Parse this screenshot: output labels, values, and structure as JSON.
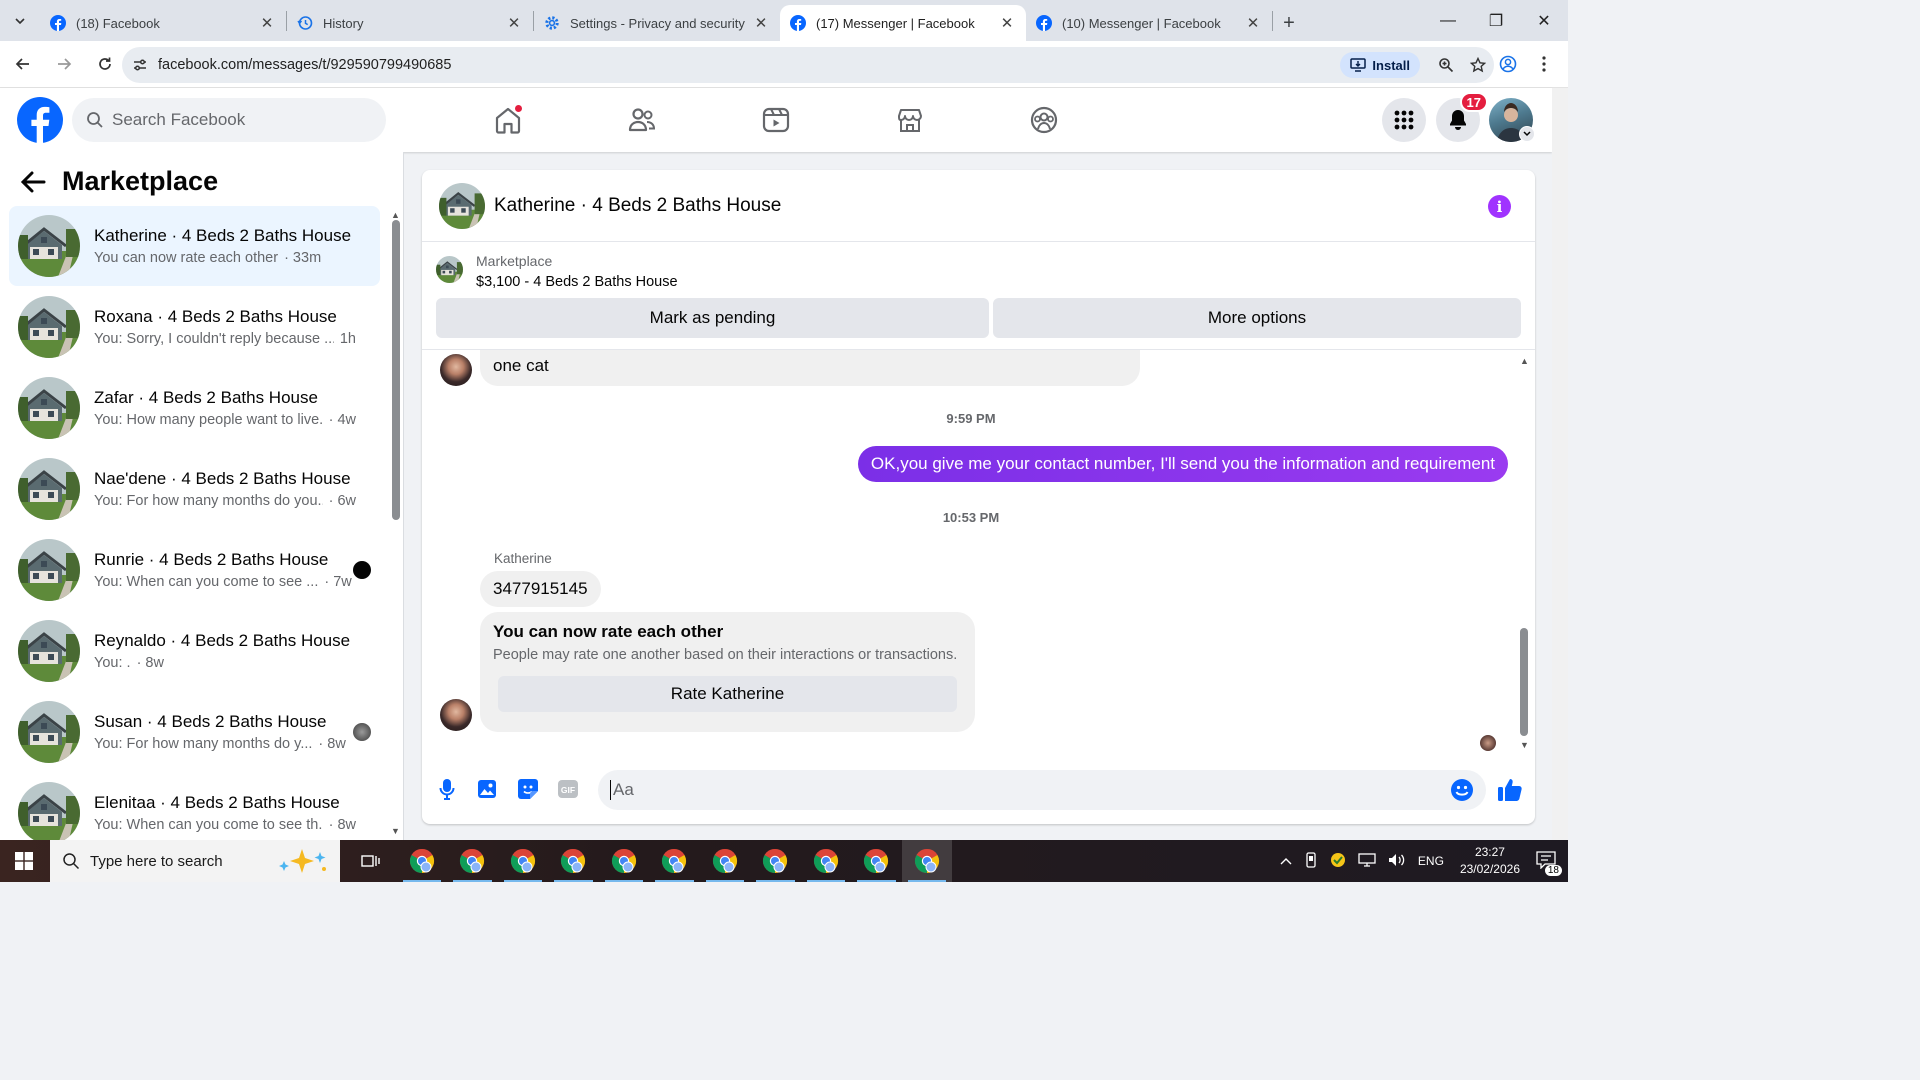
{
  "browser": {
    "tabs": [
      {
        "title": "(18) Facebook",
        "icon": "facebook-icon",
        "active": false
      },
      {
        "title": "History",
        "icon": "history-icon",
        "active": false
      },
      {
        "title": "Settings - Privacy and security",
        "icon": "gear-icon",
        "active": false
      },
      {
        "title": "(17) Messenger | Facebook",
        "icon": "facebook-icon",
        "active": true
      },
      {
        "title": "(10) Messenger | Facebook",
        "icon": "facebook-icon",
        "active": false
      }
    ],
    "url": "facebook.com/messages/t/929590799490685",
    "install_label": "Install"
  },
  "fb": {
    "search_placeholder": "Search Facebook",
    "notification_count": "17"
  },
  "sidebar": {
    "title": "Marketplace",
    "conversations": [
      {
        "name": "Katherine · 4 Beds 2 Baths House",
        "preview": "You can now rate each other",
        "time": "· 33m",
        "selected": true,
        "mark": ""
      },
      {
        "name": "Roxana · 4 Beds 2 Baths House",
        "preview": "You: Sorry, I couldn't reply because ...",
        "time": "1h",
        "selected": false,
        "mark": ""
      },
      {
        "name": "Zafar · 4 Beds 2 Baths House",
        "preview": "You: How many people want to live...",
        "time": "· 4w",
        "selected": false,
        "mark": ""
      },
      {
        "name": "Nae'dene · 4 Beds 2 Baths House",
        "preview": "You: For how many months do you...",
        "time": "· 6w",
        "selected": false,
        "mark": ""
      },
      {
        "name": "Runrie · 4 Beds 2 Baths House",
        "preview": "You: When can you come to see ...",
        "time": "· 7w",
        "selected": false,
        "mark": "unread-dot"
      },
      {
        "name": "Reynaldo · 4 Beds 2 Baths House",
        "preview": "You: .",
        "time": "· 8w",
        "selected": false,
        "mark": ""
      },
      {
        "name": "Susan · 4 Beds 2 Baths House",
        "preview": "You: For how many months do y...",
        "time": "· 8w",
        "selected": false,
        "mark": "seen-avatar"
      },
      {
        "name": "Elenitaa · 4 Beds 2 Baths House",
        "preview": "You: When can you come to see th...",
        "time": "· 8w",
        "selected": false,
        "mark": ""
      }
    ]
  },
  "chat": {
    "title": "Katherine · 4 Beds 2 Baths House",
    "marketplace_label": "Marketplace",
    "listing": "$3,100 - 4 Beds 2 Baths House",
    "mark_pending_label": "Mark as pending",
    "more_options_label": "More options",
    "messages": {
      "incoming_1": "one cat",
      "time_1": "9:59 PM",
      "outgoing_1": "OK,you give me your contact number, I'll send you the information and requirement",
      "time_2": "10:53 PM",
      "sender_name": "Katherine",
      "incoming_2": "3477915145"
    },
    "rate_card": {
      "title": "You can now rate each other",
      "subtitle": "People may rate one another based on their interactions or transactions.",
      "button": "Rate Katherine"
    },
    "composer_placeholder": "Aa"
  },
  "taskbar": {
    "search_placeholder": "Type here to search",
    "language": "ENG",
    "time": "23:27",
    "date": "23/02/2026",
    "notification_count": "18"
  },
  "colors": {
    "fb_blue": "#0866ff",
    "messenger_purple": "#8a2be2",
    "selected_row": "#ebf5ff",
    "badge_red": "#e41e3f"
  }
}
